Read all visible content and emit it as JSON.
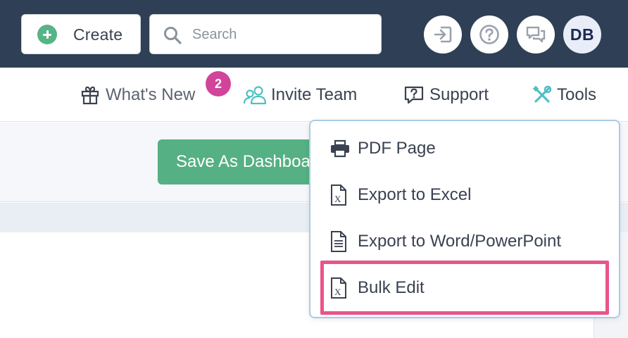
{
  "topbar": {
    "create_label": "Create",
    "search_placeholder": "Search",
    "avatar_initials": "DB"
  },
  "nav": {
    "whats_new": "What's New",
    "whats_new_count": "2",
    "invite_team": "Invite Team",
    "support": "Support",
    "tools": "Tools"
  },
  "toolbar": {
    "save_label": "Save As Dashboard"
  },
  "tools_menu": {
    "items": [
      {
        "label": "PDF Page",
        "icon": "printer-icon"
      },
      {
        "label": "Export to Excel",
        "icon": "excel-file-icon"
      },
      {
        "label": "Export to Word/PowerPoint",
        "icon": "document-file-icon"
      },
      {
        "label": "Bulk Edit",
        "icon": "excel-file-icon"
      }
    ]
  },
  "colors": {
    "topbar": "#2f3f55",
    "primary_green": "#55b083",
    "badge_pink": "#d1449a",
    "highlight_pink": "#e8558a",
    "tools_icon_teal": "#4fc0c3"
  }
}
